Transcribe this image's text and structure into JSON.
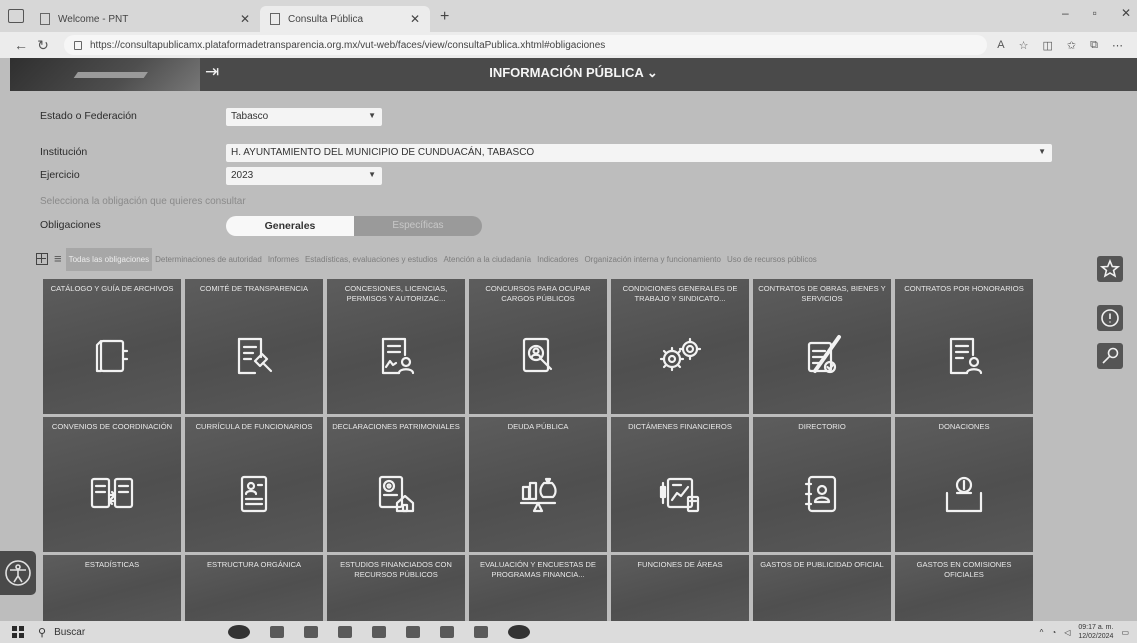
{
  "browser": {
    "tabs": [
      {
        "title": "Welcome - PNT",
        "active": false
      },
      {
        "title": "Consulta Pública",
        "active": true
      }
    ],
    "new_tab": "+",
    "window_controls": {
      "minimize": "–",
      "maximize": "▫",
      "close": "✕"
    },
    "url": "https://consultapublicamx.plataformadetransparencia.org.mx/vut-web/faces/view/consultaPublica.xhtml#obligaciones",
    "icons": [
      "read-aloud-icon",
      "favorite-star-icon",
      "split-screen-icon",
      "favorites-icon",
      "collections-icon",
      "more-icon"
    ]
  },
  "header": {
    "title": "INFORMACIÓN PÚBLICA ⌄",
    "login_glyph": "⇥"
  },
  "form": {
    "estado_label": "Estado o Federación",
    "estado_value": "Tabasco",
    "institucion_label": "Institución",
    "institucion_value": "H. AYUNTAMIENTO DEL MUNICIPIO DE CUNDUACÁN, TABASCO",
    "ejercicio_label": "Ejercicio",
    "ejercicio_value": "2023",
    "hint": "Selecciona la obligación que quieres consultar",
    "obligaciones_label": "Obligaciones",
    "toggle_generales": "Generales",
    "toggle_especificas": "Específicas"
  },
  "categories": [
    {
      "label": "Todas las obligaciones",
      "active": true
    },
    {
      "label": "Determinaciones de autoridad",
      "active": false
    },
    {
      "label": "Informes",
      "active": false
    },
    {
      "label": "Estadísticas, evaluaciones y estudios",
      "active": false
    },
    {
      "label": "Atención a la ciudadanía",
      "active": false
    },
    {
      "label": "Indicadores",
      "active": false
    },
    {
      "label": "Organización interna y funcionamiento",
      "active": false
    },
    {
      "label": "Uso de recursos públicos",
      "active": false
    }
  ],
  "tiles": [
    {
      "label": "CATÁLOGO Y GUÍA DE ARCHIVOS",
      "icon": "archive-icon"
    },
    {
      "label": "COMITÉ DE TRANSPARENCIA",
      "icon": "gavel-document-icon"
    },
    {
      "label": "CONCESIONES, LICENCIAS, PERMISOS Y AUTORIZAC...",
      "icon": "permit-document-icon"
    },
    {
      "label": "CONCURSOS PARA OCUPAR CARGOS PÚBLICOS",
      "icon": "candidate-search-icon"
    },
    {
      "label": "CONDICIONES GENERALES DE TRABAJO Y SINDICATO...",
      "icon": "gears-money-icon"
    },
    {
      "label": "CONTRATOS DE OBRAS, BIENES Y SERVICIOS",
      "icon": "contract-check-icon"
    },
    {
      "label": "CONTRATOS POR HONORARIOS",
      "icon": "document-person-icon"
    },
    {
      "label": "CONVENIOS DE COORDINACIÓN",
      "icon": "agreements-exchange-icon"
    },
    {
      "label": "CURRÍCULA DE FUNCIONARIOS",
      "icon": "resume-icon"
    },
    {
      "label": "DECLARACIONES PATRIMONIALES",
      "icon": "declaration-house-icon"
    },
    {
      "label": "DEUDA PÚBLICA",
      "icon": "debt-balance-icon"
    },
    {
      "label": "DICTÁMENES FINANCIEROS",
      "icon": "financial-chart-icon"
    },
    {
      "label": "DIRECTORIO",
      "icon": "directory-icon"
    },
    {
      "label": "DONACIONES",
      "icon": "donation-box-icon"
    },
    {
      "label": "ESTADÍSTICAS",
      "icon": "statistics-icon"
    },
    {
      "label": "ESTRUCTURA ORGÁNICA",
      "icon": "org-structure-icon"
    },
    {
      "label": "ESTUDIOS FINANCIADOS CON RECURSOS PÚBLICOS",
      "icon": "studies-icon"
    },
    {
      "label": "EVALUACIÓN Y ENCUESTAS DE PROGRAMAS FINANCIA...",
      "icon": "survey-icon"
    },
    {
      "label": "FUNCIONES DE ÁREAS",
      "icon": "functions-icon"
    },
    {
      "label": "GASTOS DE PUBLICIDAD OFICIAL",
      "icon": "advertising-icon"
    },
    {
      "label": "GASTOS EN COMISIONES OFICIALES",
      "icon": "commissions-icon"
    }
  ],
  "taskbar": {
    "search": "Buscar",
    "time": "09:17 a. m.",
    "date": "12/02/2024"
  }
}
